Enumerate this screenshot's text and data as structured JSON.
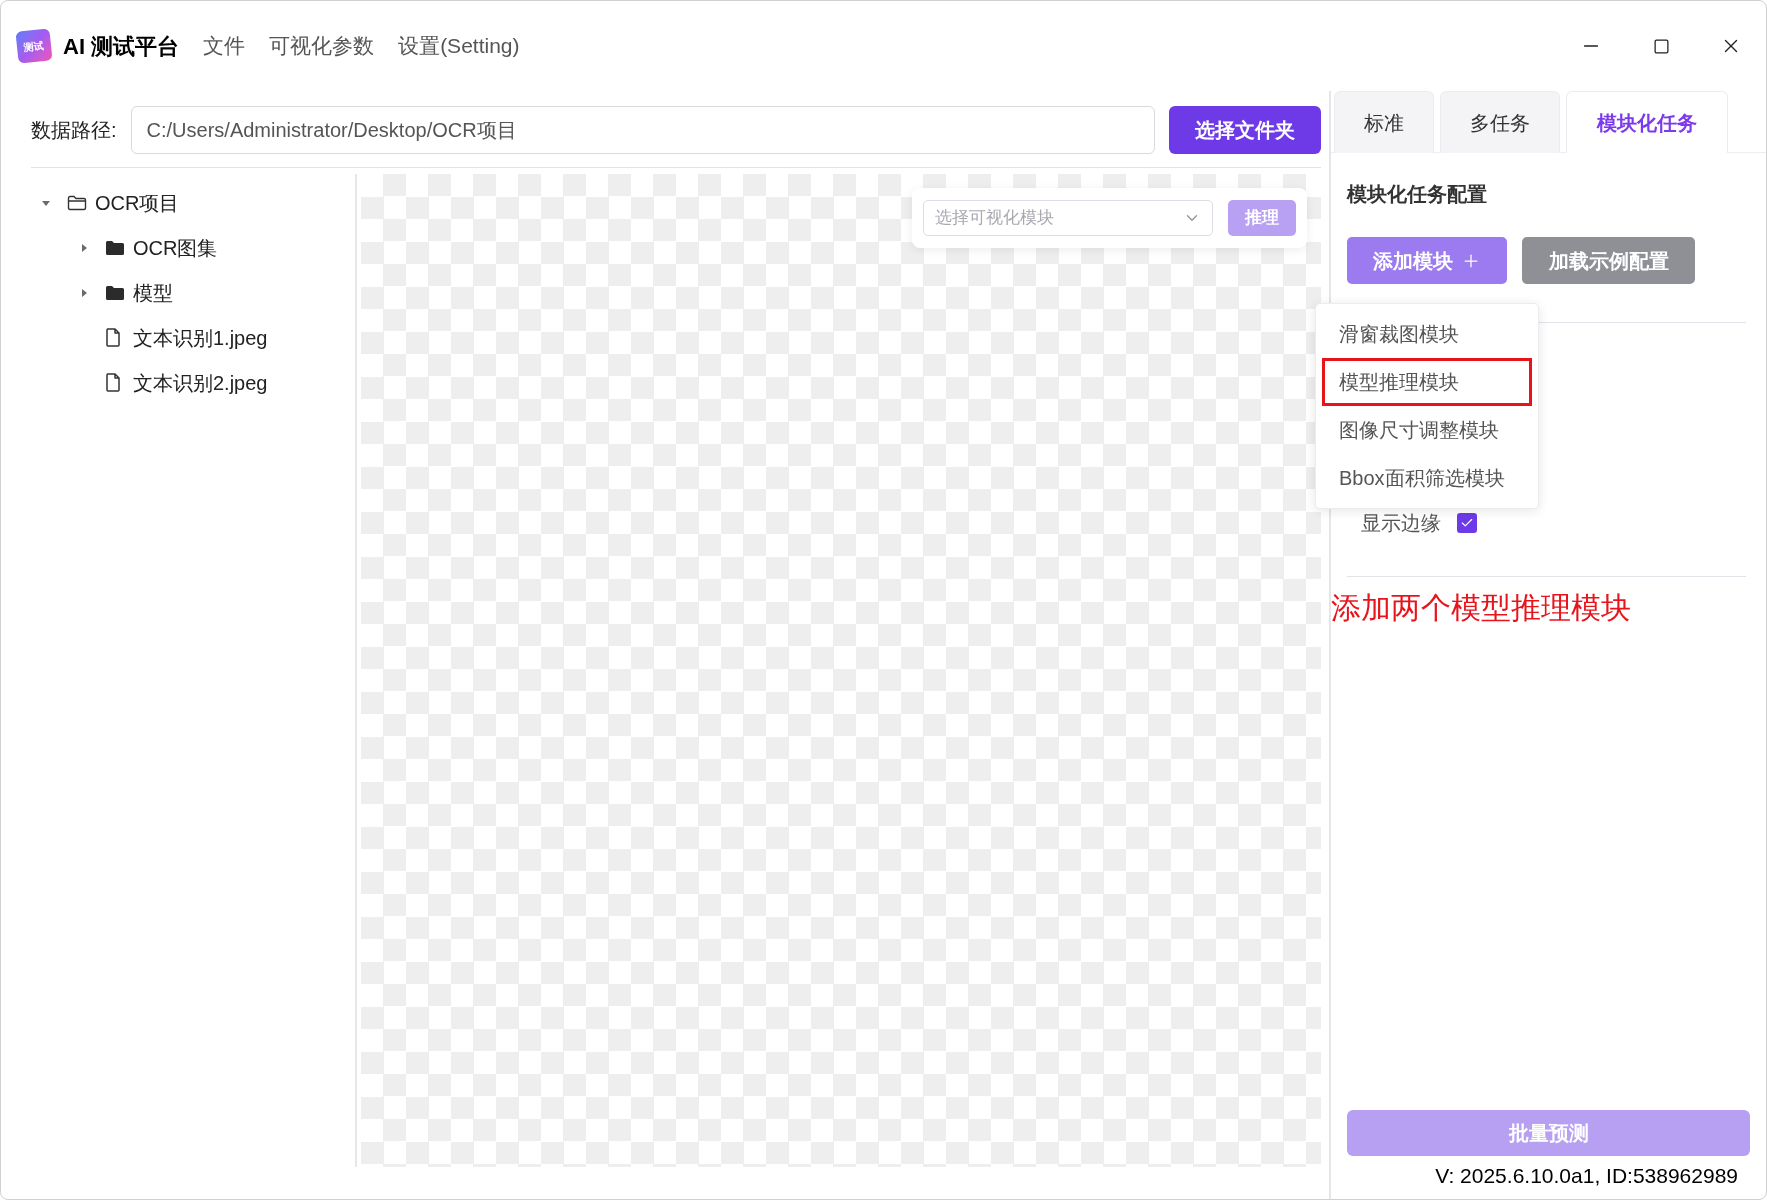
{
  "app": {
    "logo_text": "测试",
    "title": "AI 测试平台",
    "menu": [
      "文件",
      "可视化参数",
      "设置(Setting)"
    ]
  },
  "path_bar": {
    "label": "数据路径:",
    "value": "C:/Users/Administrator/Desktop/OCR项目",
    "button": "选择文件夹"
  },
  "file_tree": [
    {
      "label": "OCR项目",
      "kind": "folder",
      "expanded": true,
      "children": [
        {
          "label": "OCR图集",
          "kind": "folder",
          "expanded": false
        },
        {
          "label": "模型",
          "kind": "folder",
          "expanded": false
        },
        {
          "label": "文本识别1.jpeg",
          "kind": "file"
        },
        {
          "label": "文本识别2.jpeg",
          "kind": "file"
        }
      ]
    }
  ],
  "viewer": {
    "select_placeholder": "选择可视化模块",
    "button": "推理",
    "button_disabled": true
  },
  "tabs": [
    {
      "label": "标准",
      "selected": false
    },
    {
      "label": "多任务",
      "selected": false
    },
    {
      "label": "模块化任务",
      "selected": true
    }
  ],
  "config": {
    "title": "模块化任务配置",
    "add_button": "添加模块",
    "load_button": "加载示例配置",
    "options": [
      {
        "label": "显示边缘",
        "checked": true
      }
    ]
  },
  "add_menu": {
    "items": [
      {
        "label": "滑窗裁图模块",
        "highlighted": false
      },
      {
        "label": "模型推理模块",
        "highlighted": true
      },
      {
        "label": "图像尺寸调整模块",
        "highlighted": false
      },
      {
        "label": "Bbox面积筛选模块",
        "highlighted": false
      }
    ]
  },
  "annotation": "添加两个模型推理模块",
  "batch_button": {
    "label": "批量预测",
    "disabled": true
  },
  "version": "V: 2025.6.10.0a1, ID:538962989"
}
